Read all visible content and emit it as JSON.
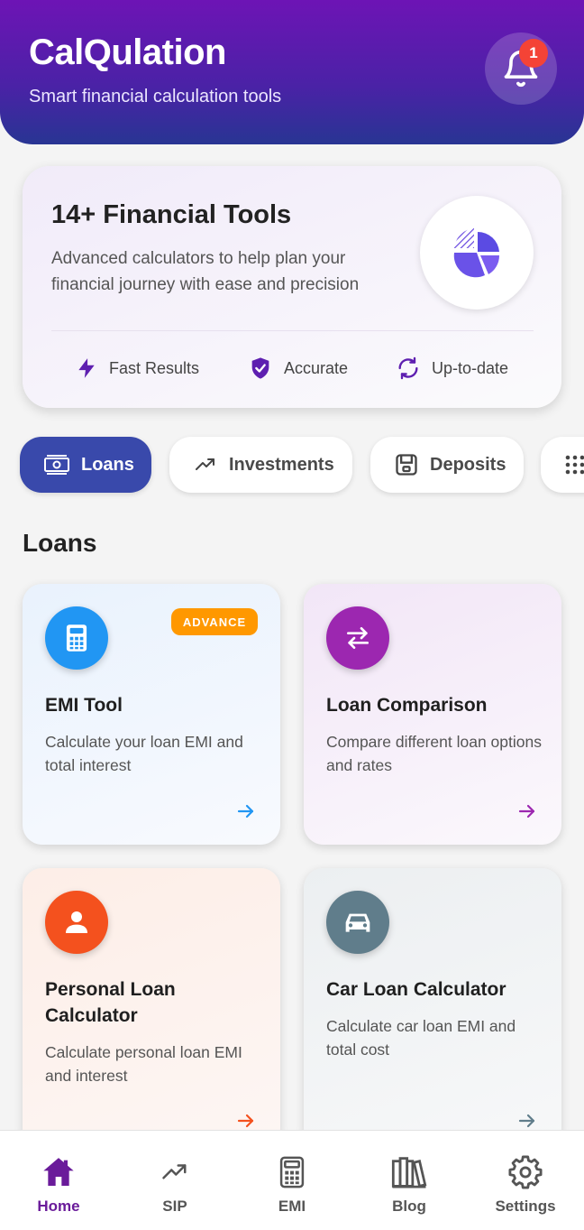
{
  "header": {
    "title": "CalQulation",
    "subtitle": "Smart financial calculation tools",
    "notification_count": "1"
  },
  "promo": {
    "title": "14+ Financial Tools",
    "description": "Advanced calculators to help plan your financial journey with ease and precision",
    "features": [
      {
        "label": "Fast Results",
        "icon": "bolt-icon"
      },
      {
        "label": "Accurate",
        "icon": "shield-check-icon"
      },
      {
        "label": "Up-to-date",
        "icon": "sync-icon"
      }
    ]
  },
  "categories": [
    {
      "label": "Loans",
      "icon": "money-icon",
      "active": true
    },
    {
      "label": "Investments",
      "icon": "trending-up-icon",
      "active": false
    },
    {
      "label": "Deposits",
      "icon": "safe-icon",
      "active": false
    },
    {
      "label": "",
      "icon": "grid-icon",
      "active": false
    }
  ],
  "section_title": "Loans",
  "tools": [
    {
      "title": "EMI Tool",
      "description": "Calculate your loan EMI and total interest",
      "icon": "calculator-icon",
      "color": "#2196f3",
      "badge": "ADVANCE"
    },
    {
      "title": "Loan Comparison",
      "description": "Compare different loan options and rates",
      "icon": "swap-icon",
      "color": "#9c27b0",
      "badge": ""
    },
    {
      "title": "Personal Loan Calculator",
      "description": "Calculate personal loan EMI and interest",
      "icon": "person-icon",
      "color": "#f4511e",
      "badge": ""
    },
    {
      "title": "Car Loan Calculator",
      "description": "Calculate car loan EMI and total cost",
      "icon": "car-icon",
      "color": "#607d8b",
      "badge": ""
    }
  ],
  "nav": [
    {
      "label": "Home",
      "icon": "home-icon",
      "active": true
    },
    {
      "label": "SIP",
      "icon": "trending-up-icon",
      "active": false
    },
    {
      "label": "EMI",
      "icon": "calculator-icon",
      "active": false
    },
    {
      "label": "Blog",
      "icon": "library-icon",
      "active": false
    },
    {
      "label": "Settings",
      "icon": "gear-icon",
      "active": false
    }
  ],
  "colors": {
    "header_top": "#6d14b5",
    "header_bottom": "#283593",
    "active_chip": "#3949ab",
    "active_nav": "#6a1b9a",
    "badge": "#ff9800"
  }
}
